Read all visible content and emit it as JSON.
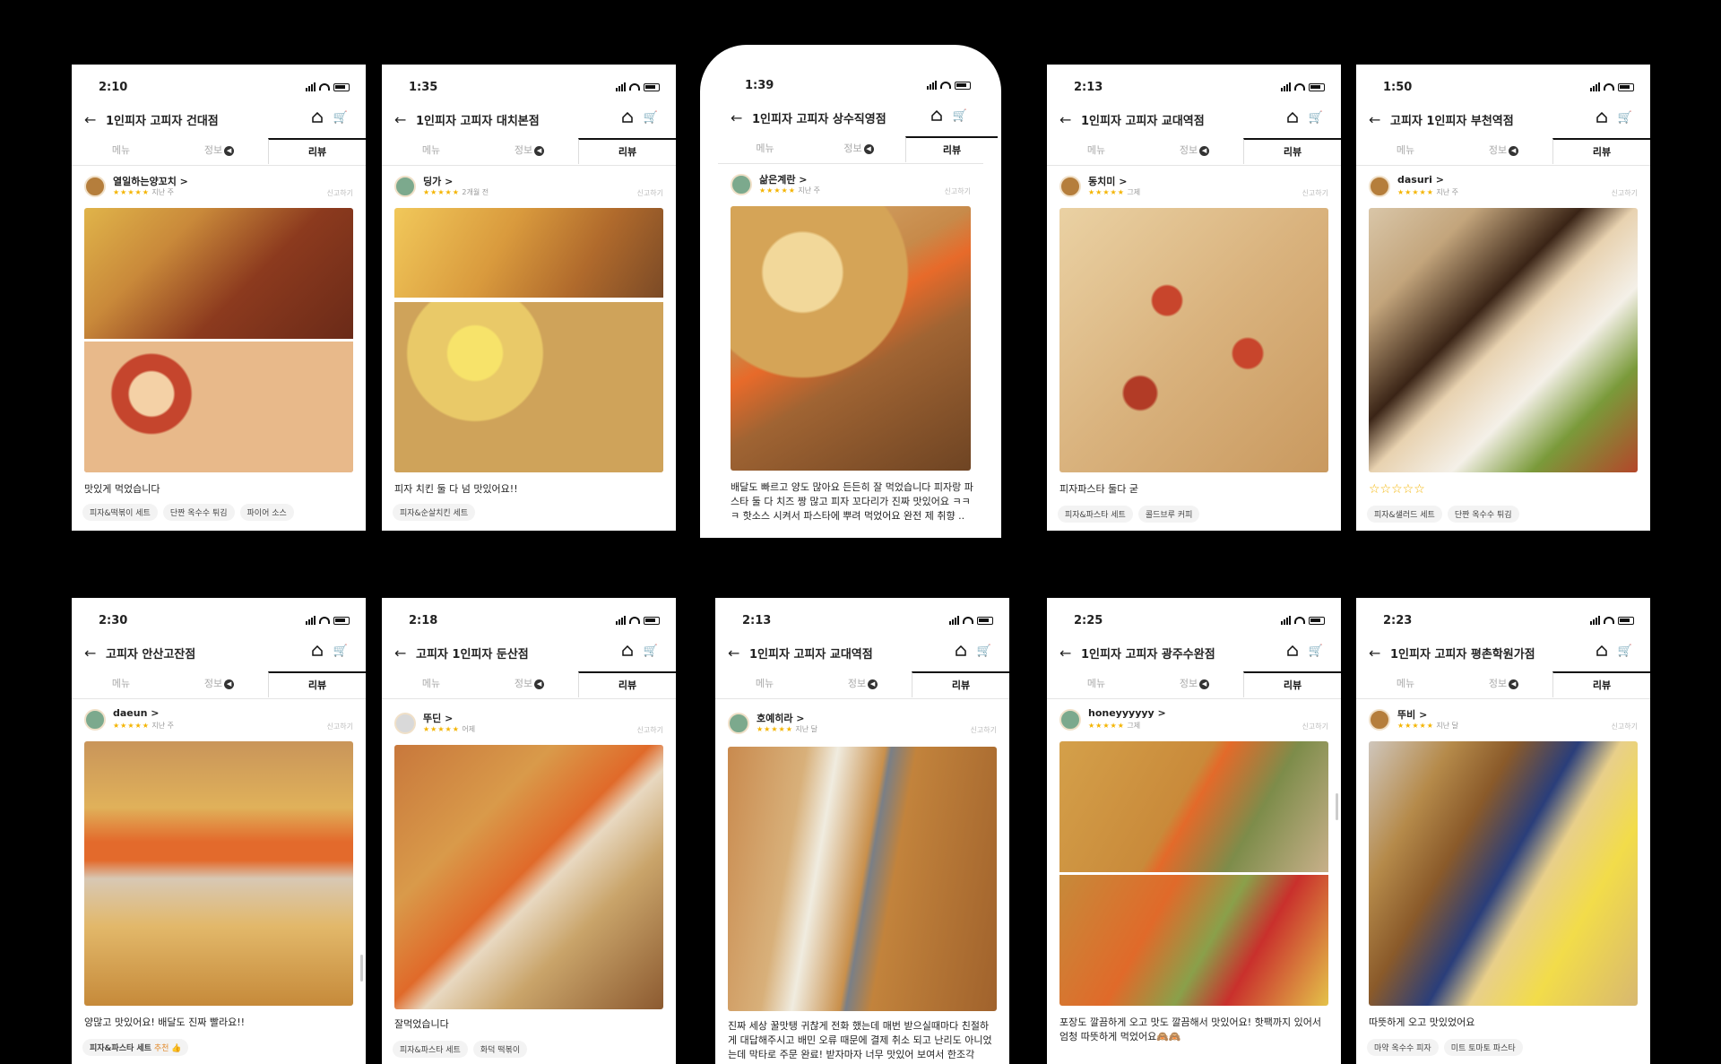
{
  "screens": [
    {
      "time": "2:10",
      "title": "1인피자 고피자 건대점",
      "tabs": [
        "메뉴",
        "정보",
        "리뷰"
      ],
      "user": "열일하는양꼬치 >",
      "stars": "★★★★★",
      "date": "지난 주",
      "report": "신고하기",
      "review": "맛있게 먹었습니다",
      "tags": [
        "피자&떡볶이 세트",
        "단짠 옥수수 튀김",
        "파이어 소스"
      ]
    },
    {
      "time": "1:35",
      "title": "1인피자 고피자 대치본점",
      "tabs": [
        "메뉴",
        "정보",
        "리뷰"
      ],
      "user": "딩가 >",
      "stars": "★★★★★",
      "date": "2개월 전",
      "report": "신고하기",
      "review": "피자 치킨 둘 다 넘 맛있어요!!",
      "tags": [
        "피자&순살치킨 세트"
      ]
    },
    {
      "time": "1:39",
      "title": "1인피자 고피자 상수직영점",
      "tabs": [
        "메뉴",
        "정보",
        "리뷰"
      ],
      "user": "삶은계란 >",
      "stars": "★★★★★",
      "date": "지난 주",
      "report": "신고하기",
      "review": "배달도 빠르고 양도 많아요 든든히 잘 먹었습니다 피자랑 파스타 둘 다 치즈 짱 많고 피자 꼬다리가 진짜 맛있어요 ㅋㅋㅋ 핫소스 시켜서 파스타에 뿌려 먹었어요 완전 제 취향 ..",
      "tags": []
    },
    {
      "time": "2:13",
      "title": "1인피자 고피자 교대역점",
      "tabs": [
        "메뉴",
        "정보",
        "리뷰"
      ],
      "user": "동치미 >",
      "stars": "★★★★★",
      "date": "그제",
      "report": "신고하기",
      "review": "피자파스타 둘다 굳",
      "tags": [
        "피자&파스타 세트",
        "콜드브루 커피"
      ]
    },
    {
      "time": "1:50",
      "title": "고피자 1인피자 부천역점",
      "tabs": [
        "메뉴",
        "정보",
        "리뷰"
      ],
      "user": "dasuri >",
      "stars": "★★★★★",
      "date": "지난 주",
      "report": "신고하기",
      "review": "☆☆☆☆☆",
      "tags": [
        "피자&샐러드 세트",
        "단짠 옥수수 튀김"
      ]
    },
    {
      "time": "2:30",
      "title": "고피자 안산고잔점",
      "tabs": [
        "메뉴",
        "정보",
        "리뷰"
      ],
      "user": "daeun >",
      "stars": "★★★★★",
      "date": "지난 주",
      "report": "신고하기",
      "review": "양많고 맛있어요! 배달도 진짜 빨라요!!",
      "tags": [
        "피자&파스타 세트"
      ],
      "tag_rec": "추천 👍"
    },
    {
      "time": "2:18",
      "title": "고피자 1인피자 둔산점",
      "tabs": [
        "메뉴",
        "정보",
        "리뷰"
      ],
      "user": "뚜딘 >",
      "stars": "★★★★★",
      "date": "어제",
      "report": "신고하기",
      "review": "잘먹었습니다",
      "tags": [
        "피자&파스타 세트",
        "화덕 떡볶이"
      ]
    },
    {
      "time": "2:13",
      "title": "1인피자 고피자 교대역점",
      "tabs": [
        "메뉴",
        "정보",
        "리뷰"
      ],
      "user": "호예히라 >",
      "stars": "★★★★★",
      "date": "지난 달",
      "report": "신고하기",
      "review": "진짜 세상 꿀맛탱 귀찮게 전화 했는데 매번 받으실때마다 친절하게 대답해주시고 배민 오류 때문에 결제 취소 되고 난리도 아니었는데 막타로 주문 완료! 받자마자 너무 맛있어 보여서 한조각",
      "tags": []
    },
    {
      "time": "2:25",
      "title": "1인피자 고피자 광주수완점",
      "tabs": [
        "메뉴",
        "정보",
        "리뷰"
      ],
      "user": "honeyyyyyy >",
      "stars": "★★★★★",
      "date": "그제",
      "report": "신고하기",
      "review": "포장도 깔끔하게 오고 맛도 깔끔해서 맛있어요! 핫팩까지 있어서 엄청 따뜻하게 먹었어요🙈🙈",
      "tags": []
    },
    {
      "time": "2:23",
      "title": "1인피자 고피자 평촌학원가점",
      "tabs": [
        "메뉴",
        "정보",
        "리뷰"
      ],
      "user": "뚜비 >",
      "stars": "★★★★★",
      "date": "지난 달",
      "report": "신고하기",
      "review": "따뜻하게 오고 맛있었어요",
      "tags": [
        "마약 옥수수 피자",
        "미트 토마토 파스타"
      ]
    }
  ]
}
